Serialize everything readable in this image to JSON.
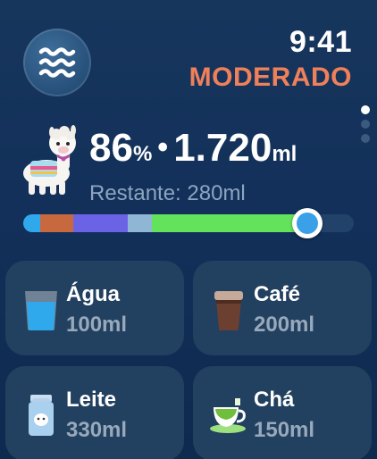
{
  "status": {
    "time": "9:41",
    "level": "MODERADO",
    "level_color": "#f0805a"
  },
  "summary": {
    "percent": "86",
    "percent_sign": "%",
    "total": "1.720",
    "total_unit": "ml",
    "remaining_label": "Restante: 280ml"
  },
  "progress": {
    "fraction": 0.86,
    "segments": [
      {
        "drink": "Água",
        "color": "#2fa9ec",
        "ml": 100
      },
      {
        "drink": "Café",
        "color": "#c8683e",
        "ml": 200
      },
      {
        "drink": "Leite",
        "color": "#6b63e6",
        "ml": 330
      },
      {
        "drink": "Chá",
        "color": "#8fb6d4",
        "ml": 150
      },
      {
        "drink": "other",
        "color": "#63e25c",
        "ml": 940
      }
    ],
    "track_color": "#22426a",
    "knob_color": "#3aa0e8"
  },
  "page_dots": {
    "count": 3,
    "active": 0
  },
  "drinks": [
    {
      "name": "Água",
      "amount": "100ml",
      "icon": "water-glass-icon"
    },
    {
      "name": "Café",
      "amount": "200ml",
      "icon": "coffee-cup-icon"
    },
    {
      "name": "Leite",
      "amount": "330ml",
      "icon": "milk-carton-icon"
    },
    {
      "name": "Chá",
      "amount": "150ml",
      "icon": "tea-cup-icon"
    }
  ],
  "icons": {
    "header_button": "waves-icon",
    "mascot": "llama-icon"
  }
}
